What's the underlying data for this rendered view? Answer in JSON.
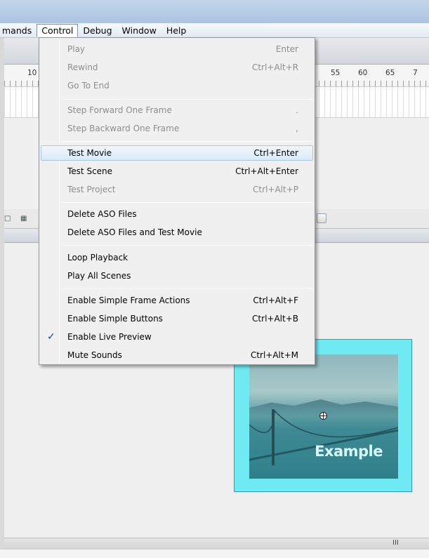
{
  "menubar": [
    {
      "label": "mands",
      "open": false
    },
    {
      "label": "Control",
      "open": true
    },
    {
      "label": "Debug",
      "open": false
    },
    {
      "label": "Window",
      "open": false
    },
    {
      "label": "Help",
      "open": false
    }
  ],
  "ruler": {
    "labels": [
      "10",
      "55",
      "60",
      "65",
      "7"
    ]
  },
  "stage": {
    "clip_caption": "Example"
  },
  "scrollbar": {
    "grip": "III"
  },
  "menu": {
    "items": [
      {
        "label": "Play",
        "shortcut": "Enter",
        "disabled": true
      },
      {
        "label": "Rewind",
        "shortcut": "Ctrl+Alt+R",
        "disabled": true
      },
      {
        "label": "Go To End",
        "shortcut": "",
        "disabled": true
      },
      {
        "label": "Step Forward One Frame",
        "shortcut": ".",
        "disabled": true
      },
      {
        "label": "Step Backward One Frame",
        "shortcut": ",",
        "disabled": true
      },
      {
        "label": "Test Movie",
        "shortcut": "Ctrl+Enter",
        "disabled": false,
        "highlighted": true
      },
      {
        "label": "Test Scene",
        "shortcut": "Ctrl+Alt+Enter",
        "disabled": false
      },
      {
        "label": "Test Project",
        "shortcut": "Ctrl+Alt+P",
        "disabled": true
      },
      {
        "label": "Delete ASO Files",
        "shortcut": "",
        "disabled": false
      },
      {
        "label": "Delete ASO Files and Test Movie",
        "shortcut": "",
        "disabled": false
      },
      {
        "label": "Loop Playback",
        "shortcut": "",
        "disabled": false
      },
      {
        "label": "Play All Scenes",
        "shortcut": "",
        "disabled": false
      },
      {
        "label": "Enable Simple Frame Actions",
        "shortcut": "Ctrl+Alt+F",
        "disabled": false
      },
      {
        "label": "Enable Simple Buttons",
        "shortcut": "Ctrl+Alt+B",
        "disabled": false
      },
      {
        "label": "Enable Live Preview",
        "shortcut": "",
        "disabled": false,
        "checked": true
      },
      {
        "label": "Mute Sounds",
        "shortcut": "Ctrl+Alt+M",
        "disabled": false
      }
    ],
    "check_glyph": "✓"
  },
  "colors": {
    "menu_highlight_border": "#a8c8ee",
    "disabled_text": "#8d8d8d",
    "clip_border": "#2a9ed0",
    "clip_fill": "#6fe9f2"
  }
}
